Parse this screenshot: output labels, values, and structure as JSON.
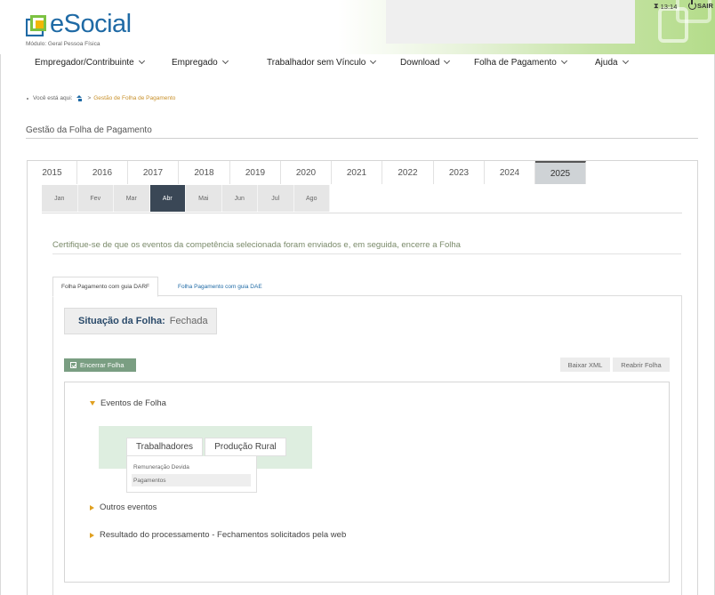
{
  "header": {
    "brand": "eSocial",
    "module": "Módulo: Geral Pessoa Física",
    "timer": "13:14",
    "logout": "SAIR"
  },
  "nav": [
    {
      "label": "Empregador/Contribuinte"
    },
    {
      "label": "Empregado"
    },
    {
      "label": "Trabalhador sem Vínculo"
    },
    {
      "label": "Download"
    },
    {
      "label": "Folha de Pagamento"
    },
    {
      "label": "Ajuda"
    }
  ],
  "breadcrumb": {
    "prefix": "Você está aqui:",
    "separator": ">",
    "current": "Gestão de Folha de Pagamento"
  },
  "page_title": "Gestão da Folha de Pagamento",
  "years": {
    "items": [
      "2015",
      "2016",
      "2017",
      "2018",
      "2019",
      "2020",
      "2021",
      "2022",
      "2023",
      "2024",
      "2025"
    ],
    "selected": "2025"
  },
  "months": {
    "items": [
      "Jan",
      "Fev",
      "Mar",
      "Abr",
      "Mai",
      "Jun",
      "Jul",
      "Ago"
    ],
    "selected": "Abr"
  },
  "notice": "Certifique-se de que os eventos da competência selecionada foram enviados e, em seguida, encerre a Folha",
  "tabs": {
    "darf": "Folha Pagamento com guia DARF",
    "dae": "Folha Pagamento com guia DAE"
  },
  "status": {
    "label": "Situação da Folha:",
    "value": "Fechada"
  },
  "buttons": {
    "encerrar": "Encerrar Folha",
    "baixar_xml": "Baixar XML",
    "reabrir": "Reabrir Folha"
  },
  "events": {
    "folha": "Eventos de Folha",
    "subtabs": [
      "Trabalhadores",
      "Produção Rural"
    ],
    "menu": [
      "Remuneração Devida",
      "Pagamentos"
    ],
    "menu_selected": "Pagamentos",
    "outros": "Outros eventos",
    "resultado": "Resultado do processamento - Fechamentos solicitados pela web"
  },
  "colors": {
    "brand_blue": "#1f6aa5",
    "active_month": "#3a4756",
    "encerrar_button": "#7a9e82",
    "triangle": "#e0a020"
  },
  "icons": {
    "logo": "esocial-logo-icon",
    "timer": "hourglass-icon",
    "logout": "power-icon",
    "home": "home-icon",
    "encerrar": "checkbox-icon"
  }
}
